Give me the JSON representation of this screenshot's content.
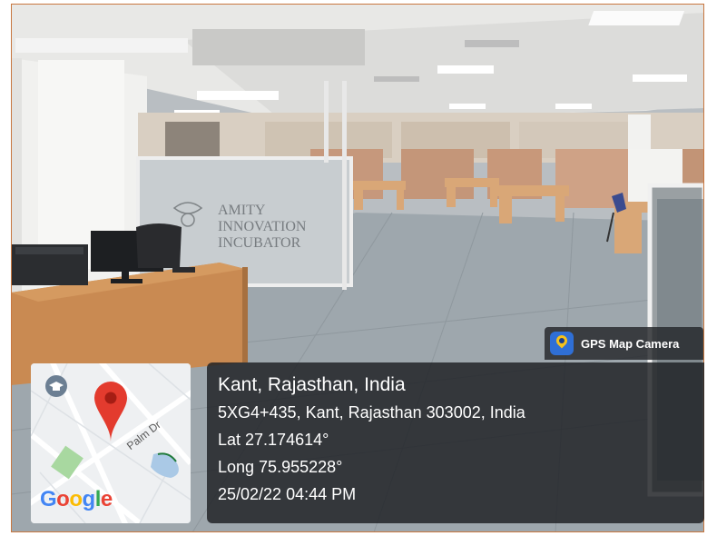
{
  "stamp": {
    "app_name": "GPS Map Camera",
    "place": "Kant, Rajasthan, India",
    "address": "5XG4+435, Kant, Rajasthan 303002, India",
    "latitude": "Lat 27.174614°",
    "longitude": "Long 75.955228°",
    "datetime": "25/02/22 04:44 PM"
  },
  "map": {
    "brand": "Google",
    "street": "Palm Dr"
  },
  "scene": {
    "glass_sign_lines": [
      "AMITY",
      "INNOVATION",
      "INCUBATOR"
    ]
  },
  "colors": {
    "marker_red": "#e33b2e",
    "brand_blue": "#4285f4",
    "brand_red": "#ea4335",
    "brand_yellow": "#fbbc05",
    "brand_green": "#34a853"
  },
  "icons": [
    "gps-map-camera-app-icon",
    "location-pin-icon",
    "education-place-icon"
  ]
}
